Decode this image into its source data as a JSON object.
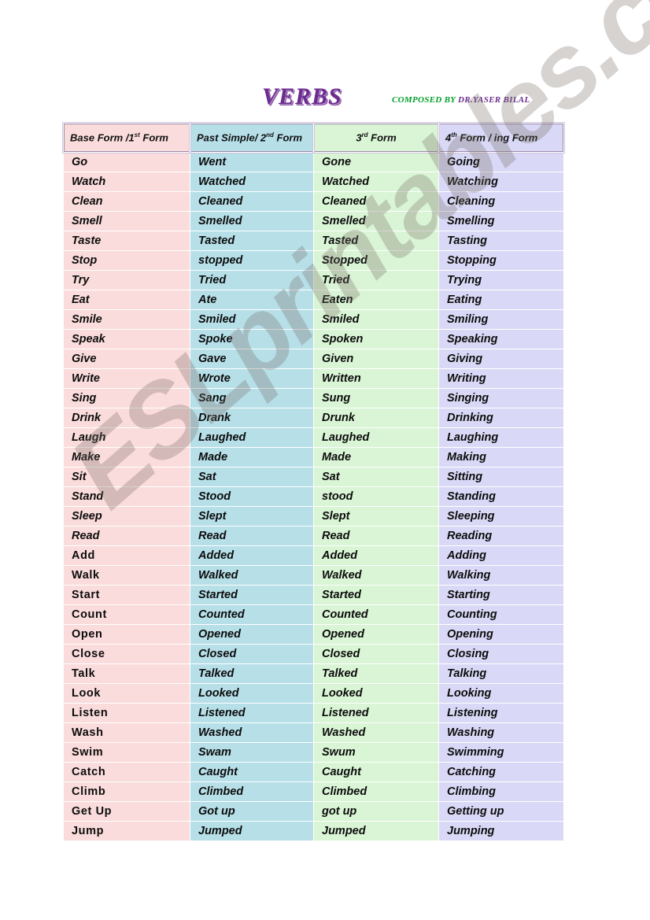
{
  "page": {
    "title": "VERBS",
    "credit_composed": "COMPOSED BY",
    "credit_author": "DR.YASER  BILAL",
    "watermark": "ESLprintables.com"
  },
  "colors": {
    "title": "#6b2d8f",
    "credit_composed": "#00a02a",
    "credit_author": "#6b2d8f",
    "col1_bg": "#fbdcdc",
    "col2_bg": "#b6dfe8",
    "col3_bg": "#d9f5d5",
    "col4_bg": "#d9d9f7",
    "header_border": "#9a8aa8"
  },
  "table": {
    "headers": [
      {
        "main": "Base Form /1",
        "sup": "st",
        "tail": " Form"
      },
      {
        "main": "Past Simple/ 2",
        "sup": "nd",
        "tail": " Form"
      },
      {
        "main": "3",
        "sup": "rd",
        "tail": " Form"
      },
      {
        "main": "4",
        "sup": "th",
        "tail": " Form / ing Form"
      }
    ],
    "rows": [
      {
        "base": "Go",
        "past": "Went",
        "third": "Gone",
        "ing": "Going",
        "base_upright": false
      },
      {
        "base": "Watch",
        "past": "Watched",
        "third": "Watched",
        "ing": "Watching",
        "base_upright": false
      },
      {
        "base": "Clean",
        "past": "Cleaned",
        "third": "Cleaned",
        "ing": "Cleaning",
        "base_upright": false
      },
      {
        "base": "Smell",
        "past": "Smelled",
        "third": "Smelled",
        "ing": "Smelling",
        "base_upright": false
      },
      {
        "base": "Taste",
        "past": "Tasted",
        "third": "Tasted",
        "ing": "Tasting",
        "base_upright": false
      },
      {
        "base": "Stop",
        "past": "stopped",
        "third": "Stopped",
        "ing": "Stopping",
        "base_upright": false
      },
      {
        "base": "Try",
        "past": "Tried",
        "third": "Tried",
        "ing": "Trying",
        "base_upright": false
      },
      {
        "base": "Eat",
        "past": "Ate",
        "third": "Eaten",
        "ing": "Eating",
        "base_upright": false
      },
      {
        "base": "Smile",
        "past": "Smiled",
        "third": "Smiled",
        "ing": "Smiling",
        "base_upright": false
      },
      {
        "base": "Speak",
        "past": "Spoke",
        "third": "Spoken",
        "ing": "Speaking",
        "base_upright": false
      },
      {
        "base": "Give",
        "past": "Gave",
        "third": "Given",
        "ing": "Giving",
        "base_upright": false
      },
      {
        "base": "Write",
        "past": "Wrote",
        "third": "Written",
        "ing": "Writing",
        "base_upright": false
      },
      {
        "base": "Sing",
        "past": "Sang",
        "third": "Sung",
        "ing": "Singing",
        "base_upright": false
      },
      {
        "base": "Drink",
        "past": "Drank",
        "third": "Drunk",
        "ing": "Drinking",
        "base_upright": false
      },
      {
        "base": "Laugh",
        "past": "Laughed",
        "third": "Laughed",
        "ing": "Laughing",
        "base_upright": false
      },
      {
        "base": "Make",
        "past": "Made",
        "third": "Made",
        "ing": "Making",
        "base_upright": false
      },
      {
        "base": "Sit",
        "past": "Sat",
        "third": "Sat",
        "ing": "Sitting",
        "base_upright": false
      },
      {
        "base": "Stand",
        "past": "Stood",
        "third": "stood",
        "ing": "Standing",
        "base_upright": false
      },
      {
        "base": "Sleep",
        "past": "Slept",
        "third": "Slept",
        "ing": "Sleeping",
        "base_upright": false
      },
      {
        "base": "Read",
        "past": "Read",
        "third": "Read",
        "ing": "Reading",
        "base_upright": false
      },
      {
        "base": "Add",
        "past": "Added",
        "third": "Added",
        "ing": "Adding",
        "base_upright": true
      },
      {
        "base": "Walk",
        "past": "Walked",
        "third": "Walked",
        "ing": "Walking",
        "base_upright": true
      },
      {
        "base": "Start",
        "past": "Started",
        "third": "Started",
        "ing": "Starting",
        "base_upright": true
      },
      {
        "base": "Count",
        "past": "Counted",
        "third": "Counted",
        "ing": "Counting",
        "base_upright": true
      },
      {
        "base": "Open",
        "past": "Opened",
        "third": "Opened",
        "ing": "Opening",
        "base_upright": true
      },
      {
        "base": "Close",
        "past": "Closed",
        "third": "Closed",
        "ing": "Closing",
        "base_upright": true
      },
      {
        "base": "Talk",
        "past": "Talked",
        "third": "Talked",
        "ing": "Talking",
        "base_upright": true
      },
      {
        "base": "Look",
        "past": "Looked",
        "third": "Looked",
        "ing": "Looking",
        "base_upright": true
      },
      {
        "base": "Listen",
        "past": "Listened",
        "third": "Listened",
        "ing": "Listening",
        "base_upright": true
      },
      {
        "base": "Wash",
        "past": "Washed",
        "third": "Washed",
        "ing": "Washing",
        "base_upright": true
      },
      {
        "base": "Swim",
        "past": "Swam",
        "third": "Swum",
        "ing": "Swimming",
        "base_upright": true
      },
      {
        "base": "Catch",
        "past": "Caught",
        "third": "Caught",
        "ing": "Catching",
        "base_upright": true
      },
      {
        "base": "Climb",
        "past": "Climbed",
        "third": "Climbed",
        "ing": "Climbing",
        "base_upright": true
      },
      {
        "base": "Get Up",
        "past": "Got up",
        "third": "got up",
        "ing": "Getting up",
        "base_upright": true
      },
      {
        "base": "Jump",
        "past": "Jumped",
        "third": "Jumped",
        "ing": "Jumping",
        "base_upright": true
      }
    ]
  }
}
